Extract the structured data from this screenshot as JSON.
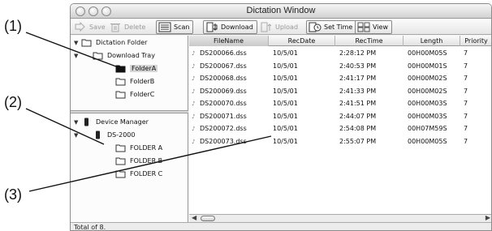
{
  "callouts": [
    "(1)",
    "(2)",
    "(3)"
  ],
  "window": {
    "title": "Dictation Window"
  },
  "toolbar": {
    "save": "Save",
    "delete": "Delete",
    "scan": "Scan",
    "download": "Download",
    "upload": "Upload",
    "set_time": "Set Time",
    "view": "View"
  },
  "tree": {
    "root": "Dictation Folder",
    "tray": "Download Tray",
    "folders": [
      "FolderA",
      "FolderB",
      "FolderC"
    ],
    "device_manager": "Device Manager",
    "device": "DS-2000",
    "device_folders": [
      "FOLDER A",
      "FOLDER B",
      "FOLDER C"
    ]
  },
  "table": {
    "columns": [
      "FileName",
      "RecDate",
      "RecTime",
      "Length",
      "Priority"
    ],
    "rows": [
      [
        "DS200066.dss",
        "10/5/01",
        "2:28:12 PM",
        "00H00M05S",
        "7"
      ],
      [
        "DS200067.dss",
        "10/5/01",
        "2:40:53 PM",
        "00H00M01S",
        "7"
      ],
      [
        "DS200068.dss",
        "10/5/01",
        "2:41:17 PM",
        "00H00M02S",
        "7"
      ],
      [
        "DS200069.dss",
        "10/5/01",
        "2:41:33 PM",
        "00H00M02S",
        "7"
      ],
      [
        "DS200070.dss",
        "10/5/01",
        "2:41:51 PM",
        "00H00M03S",
        "7"
      ],
      [
        "DS200071.dss",
        "10/5/01",
        "2:44:07 PM",
        "00H00M03S",
        "7"
      ],
      [
        "DS200072.dss",
        "10/5/01",
        "2:54:08 PM",
        "00H07M59S",
        "7"
      ],
      [
        "DS200073.dss",
        "10/5/01",
        "2:55:07 PM",
        "00H00M05S",
        "7"
      ]
    ]
  },
  "status": {
    "text": "Total of 8."
  }
}
